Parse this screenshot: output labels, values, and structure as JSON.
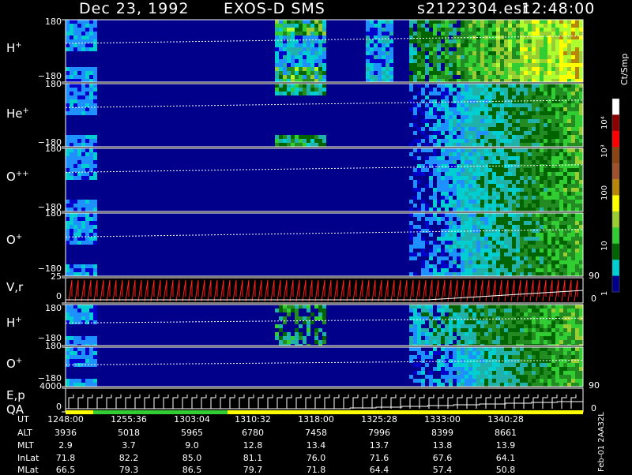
{
  "header": {
    "date": "Dec 23, 1992",
    "instrument": "EXOS-D SMS",
    "file": "s2122304.esr",
    "time": "12:48:00"
  },
  "panels": [
    {
      "id": "p1",
      "species": "H",
      "charge": "+",
      "top_tick": "180",
      "bottom_tick": "−180"
    },
    {
      "id": "p2",
      "species": "He",
      "charge": "+",
      "top_tick": "180",
      "bottom_tick": "−180"
    },
    {
      "id": "p3",
      "species": "O",
      "charge": "++",
      "top_tick": "180",
      "bottom_tick": "−180"
    },
    {
      "id": "p4",
      "species": "O",
      "charge": "+",
      "top_tick": "180",
      "bottom_tick": "−180"
    },
    {
      "id": "p5",
      "species": "V,r",
      "charge": "",
      "top_tick": "25",
      "bottom_tick": "0",
      "right_top": "90",
      "right_bottom": "0"
    },
    {
      "id": "p6",
      "species": "H",
      "charge": "+",
      "top_tick": "180",
      "bottom_tick": "−180"
    },
    {
      "id": "p7",
      "species": "O",
      "charge": "+",
      "top_tick": "180",
      "bottom_tick": "−180"
    },
    {
      "id": "p8",
      "species": "E,p",
      "species2": "QA",
      "charge": "",
      "top_tick": "4000",
      "bottom_tick": "0",
      "right_top": "90",
      "right_bottom": "0"
    }
  ],
  "colorbar": {
    "unit_label": "Ct/Smp",
    "tick_labels": [
      "10⁴",
      "10³",
      "100",
      "10",
      "1"
    ],
    "colors": [
      "#ffffff",
      "#8b0000",
      "#ff0000",
      "#8b4513",
      "#a0522d",
      "#b8860b",
      "#ffff00",
      "#9acd32",
      "#32cd32",
      "#006400",
      "#00ced1",
      "#00008b"
    ]
  },
  "table": {
    "rows": [
      {
        "label": "UT",
        "values": [
          "1248:00",
          "1255:36",
          "1303:04",
          "1310:32",
          "1318:00",
          "1325:28",
          "1333:00",
          "1340:28"
        ]
      },
      {
        "label": "ALT",
        "values": [
          "3936",
          "5018",
          "5965",
          "6780",
          "7458",
          "7996",
          "8399",
          "8661"
        ]
      },
      {
        "label": "MLT",
        "values": [
          "2.9",
          "3.7",
          "9.0",
          "12.8",
          "13.4",
          "13.7",
          "13.8",
          "13.9"
        ]
      },
      {
        "label": "InLat",
        "values": [
          "71.8",
          "82.2",
          "85.0",
          "81.1",
          "76.0",
          "71.6",
          "67.6",
          "64.1"
        ]
      },
      {
        "label": "MLat",
        "values": [
          "66.5",
          "79.3",
          "86.5",
          "79.7",
          "71.8",
          "64.4",
          "57.4",
          "50.8"
        ]
      }
    ]
  },
  "footer_side_label": "Feb-01  2AA32L",
  "chart_data": {
    "type": "heatmap",
    "title": "Dec 23, 1992   EXOS-D SMS",
    "x_ticks": [
      "1248:00",
      "1255:36",
      "1303:04",
      "1310:32",
      "1318:00",
      "1325:28",
      "1333:00",
      "1340:28"
    ],
    "panels": [
      "H+",
      "He+",
      "O++",
      "O+",
      "V,r",
      "H+",
      "O+",
      "E,p QA"
    ],
    "y_range_pitch": [
      -180,
      180
    ],
    "v_range": [
      0,
      25
    ],
    "e_range": [
      0,
      4000
    ],
    "right_axis_range": [
      0,
      90
    ],
    "colorbar_unit": "Ct/Smp",
    "colorbar_range": [
      1,
      10000
    ],
    "colorbar_scale": "log"
  }
}
